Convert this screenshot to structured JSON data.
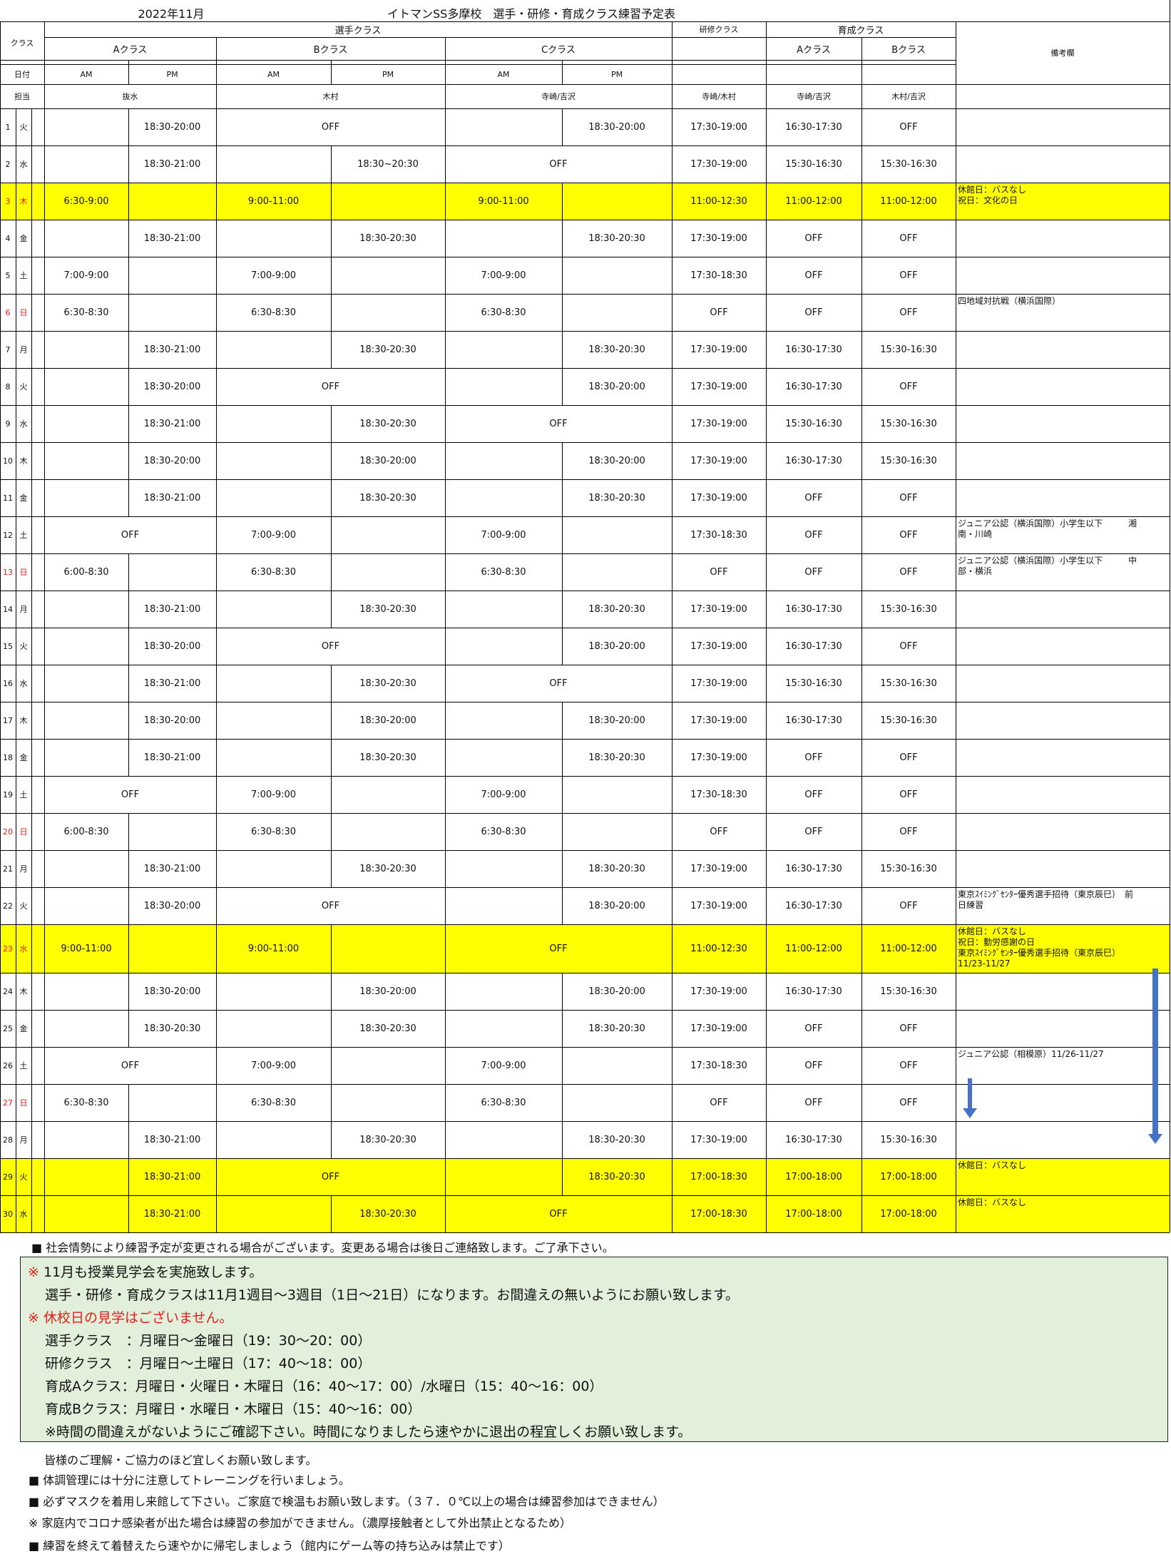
{
  "header": {
    "month": "2022年11月",
    "title": "イトマンSS多摩校　選手・研修・育成クラス練習予定表"
  },
  "labels": {
    "class": "クラス",
    "date": "日付",
    "staff": "担当",
    "senshu": "選手クラス",
    "kenshu": "研修クラス",
    "ikusei": "育成クラス",
    "a_class": "Aクラス",
    "b_class": "Bクラス",
    "c_class": "Cクラス",
    "biko": "備考欄",
    "am": "AM",
    "pm": "PM"
  },
  "staff": {
    "a": "抜水",
    "b": "木村",
    "c": "寺崎/吉沢",
    "kenshu": "寺崎/木村",
    "ikusei_a": "寺崎/吉沢",
    "ikusei_b": "木村/吉沢"
  },
  "colors": {
    "highlight": "#ffff00",
    "holiday_text": "#e0201a",
    "notes_background": "#e2efda",
    "arrow": "#4472c4"
  },
  "rows": [
    {
      "day": "1",
      "wd": "火",
      "red": false,
      "hl": false,
      "a": [
        "",
        "18:30-20:00"
      ],
      "b": [
        "OFF"
      ],
      "c": [
        "",
        "18:30-20:00"
      ],
      "ken": "17:30-19:00",
      "ia": "16:30-17:30",
      "ib": "OFF",
      "note": ""
    },
    {
      "day": "2",
      "wd": "水",
      "red": false,
      "hl": false,
      "a": [
        "",
        "18:30-21:00"
      ],
      "b": [
        "",
        "18:30~20:30"
      ],
      "c": [
        "OFF"
      ],
      "ken": "17:30-19:00",
      "ia": "15:30-16:30",
      "ib": "15:30-16:30",
      "note": ""
    },
    {
      "day": "3",
      "wd": "木",
      "red": true,
      "hl": true,
      "a": [
        "6:30-9:00",
        ""
      ],
      "b": [
        "9:00-11:00",
        ""
      ],
      "c": [
        "9:00-11:00",
        ""
      ],
      "ken": "11:00-12:30",
      "ia": "11:00-12:00",
      "ib": "11:00-12:00",
      "note": "休館日：バスなし\n祝日：文化の日"
    },
    {
      "day": "4",
      "wd": "金",
      "red": false,
      "hl": false,
      "a": [
        "",
        "18:30-21:00"
      ],
      "b": [
        "",
        "18:30-20:30"
      ],
      "c": [
        "",
        "18:30-20:30"
      ],
      "ken": "17:30-19:00",
      "ia": "OFF",
      "ib": "OFF",
      "note": ""
    },
    {
      "day": "5",
      "wd": "土",
      "red": false,
      "hl": false,
      "a": [
        "7:00-9:00",
        ""
      ],
      "b": [
        "7:00-9:00",
        ""
      ],
      "c": [
        "7:00-9:00",
        ""
      ],
      "ken": "17:30-18:30",
      "ia": "OFF",
      "ib": "OFF",
      "note": ""
    },
    {
      "day": "6",
      "wd": "日",
      "red": true,
      "hl": false,
      "a": [
        "6:30-8:30",
        ""
      ],
      "b": [
        "6:30-8:30",
        ""
      ],
      "c": [
        "6:30-8:30",
        ""
      ],
      "ken": "OFF",
      "ia": "OFF",
      "ib": "OFF",
      "note": "四地域対抗戦（横浜国際）"
    },
    {
      "day": "7",
      "wd": "月",
      "red": false,
      "hl": false,
      "a": [
        "",
        "18:30-21:00"
      ],
      "b": [
        "",
        "18:30-20:30"
      ],
      "c": [
        "",
        "18:30-20:30"
      ],
      "ken": "17:30-19:00",
      "ia": "16:30-17:30",
      "ib": "15:30-16:30",
      "note": ""
    },
    {
      "day": "8",
      "wd": "火",
      "red": false,
      "hl": false,
      "a": [
        "",
        "18:30-20:00"
      ],
      "b": [
        "OFF"
      ],
      "c": [
        "",
        "18:30-20:00"
      ],
      "ken": "17:30-19:00",
      "ia": "16:30-17:30",
      "ib": "OFF",
      "note": ""
    },
    {
      "day": "9",
      "wd": "水",
      "red": false,
      "hl": false,
      "a": [
        "",
        "18:30-21:00"
      ],
      "b": [
        "",
        "18:30-20:30"
      ],
      "c": [
        "OFF"
      ],
      "ken": "17:30-19:00",
      "ia": "15:30-16:30",
      "ib": "15:30-16:30",
      "note": ""
    },
    {
      "day": "10",
      "wd": "木",
      "red": false,
      "hl": false,
      "a": [
        "",
        "18:30-20:00"
      ],
      "b": [
        "",
        "18:30-20:00"
      ],
      "c": [
        "",
        "18:30-20:00"
      ],
      "ken": "17:30-19:00",
      "ia": "16:30-17:30",
      "ib": "15:30-16:30",
      "note": ""
    },
    {
      "day": "11",
      "wd": "金",
      "red": false,
      "hl": false,
      "a": [
        "",
        "18:30-21:00"
      ],
      "b": [
        "",
        "18:30-20:30"
      ],
      "c": [
        "",
        "18:30-20:30"
      ],
      "ken": "17:30-19:00",
      "ia": "OFF",
      "ib": "OFF",
      "note": ""
    },
    {
      "day": "12",
      "wd": "土",
      "red": false,
      "hl": false,
      "a": [
        "OFF"
      ],
      "b": [
        "7:00-9:00",
        ""
      ],
      "c": [
        "7:00-9:00",
        ""
      ],
      "ken": "17:30-18:30",
      "ia": "OFF",
      "ib": "OFF",
      "note": "ジュニア公認（横浜国際）小学生以下　　　湘\n南・川崎"
    },
    {
      "day": "13",
      "wd": "日",
      "red": true,
      "hl": false,
      "a": [
        "6:00-8:30",
        ""
      ],
      "b": [
        "6:30-8:30",
        ""
      ],
      "c": [
        "6:30-8:30",
        ""
      ],
      "ken": "OFF",
      "ia": "OFF",
      "ib": "OFF",
      "note": "ジュニア公認（横浜国際）小学生以下　　　中\n部・横浜"
    },
    {
      "day": "14",
      "wd": "月",
      "red": false,
      "hl": false,
      "a": [
        "",
        "18:30-21:00"
      ],
      "b": [
        "",
        "18:30-20:30"
      ],
      "c": [
        "",
        "18:30-20:30"
      ],
      "ken": "17:30-19:00",
      "ia": "16:30-17:30",
      "ib": "15:30-16:30",
      "note": ""
    },
    {
      "day": "15",
      "wd": "火",
      "red": false,
      "hl": false,
      "a": [
        "",
        "18:30-20:00"
      ],
      "b": [
        "OFF"
      ],
      "c": [
        "",
        "18:30-20:00"
      ],
      "ken": "17:30-19:00",
      "ia": "16:30-17:30",
      "ib": "OFF",
      "note": ""
    },
    {
      "day": "16",
      "wd": "水",
      "red": false,
      "hl": false,
      "a": [
        "",
        "18:30-21:00"
      ],
      "b": [
        "",
        "18:30-20:30"
      ],
      "c": [
        "OFF"
      ],
      "ken": "17:30-19:00",
      "ia": "15:30-16:30",
      "ib": "15:30-16:30",
      "note": ""
    },
    {
      "day": "17",
      "wd": "木",
      "red": false,
      "hl": false,
      "a": [
        "",
        "18:30-20:00"
      ],
      "b": [
        "",
        "18:30-20:00"
      ],
      "c": [
        "",
        "18:30-20:00"
      ],
      "ken": "17:30-19:00",
      "ia": "16:30-17:30",
      "ib": "15:30-16:30",
      "note": ""
    },
    {
      "day": "18",
      "wd": "金",
      "red": false,
      "hl": false,
      "a": [
        "",
        "18:30-21:00"
      ],
      "b": [
        "",
        "18:30-20:30"
      ],
      "c": [
        "",
        "18:30-20:30"
      ],
      "ken": "17:30-19:00",
      "ia": "OFF",
      "ib": "OFF",
      "note": ""
    },
    {
      "day": "19",
      "wd": "土",
      "red": false,
      "hl": false,
      "a": [
        "OFF"
      ],
      "b": [
        "7:00-9:00",
        ""
      ],
      "c": [
        "7:00-9:00",
        ""
      ],
      "ken": "17:30-18:30",
      "ia": "OFF",
      "ib": "OFF",
      "note": ""
    },
    {
      "day": "20",
      "wd": "日",
      "red": true,
      "hl": false,
      "a": [
        "6:00-8:30",
        ""
      ],
      "b": [
        "6:30-8:30",
        ""
      ],
      "c": [
        "6:30-8:30",
        ""
      ],
      "ken": "OFF",
      "ia": "OFF",
      "ib": "OFF",
      "note": ""
    },
    {
      "day": "21",
      "wd": "月",
      "red": false,
      "hl": false,
      "a": [
        "",
        "18:30-21:00"
      ],
      "b": [
        "",
        "18:30-20:30"
      ],
      "c": [
        "",
        "18:30-20:30"
      ],
      "ken": "17:30-19:00",
      "ia": "16:30-17:30",
      "ib": "15:30-16:30",
      "note": ""
    },
    {
      "day": "22",
      "wd": "火",
      "red": false,
      "hl": false,
      "a": [
        "",
        "18:30-20:00"
      ],
      "b": [
        "OFF"
      ],
      "c": [
        "",
        "18:30-20:00"
      ],
      "ken": "17:30-19:00",
      "ia": "16:30-17:30",
      "ib": "OFF",
      "note": "東京ｽｲﾐﾝｸﾞｾﾝﾀｰ優秀選手招待（東京辰巳）　前\n日練習"
    },
    {
      "day": "23",
      "wd": "水",
      "red": true,
      "hl": true,
      "a": [
        "9:00-11:00",
        ""
      ],
      "b": [
        "9:00-11:00",
        ""
      ],
      "c": [
        "OFF"
      ],
      "ken": "11:00-12:30",
      "ia": "11:00-12:00",
      "ib": "11:00-12:00",
      "note": "休館日：バスなし\n祝日：勤労感謝の日\n東京ｽｲﾐﾝｸﾞｾﾝﾀｰ優秀選手招待（東京辰巳）\n11/23-11/27"
    },
    {
      "day": "24",
      "wd": "木",
      "red": false,
      "hl": false,
      "a": [
        "",
        "18:30-20:00"
      ],
      "b": [
        "",
        "18:30-20:00"
      ],
      "c": [
        "",
        "18:30-20:00"
      ],
      "ken": "17:30-19:00",
      "ia": "16:30-17:30",
      "ib": "15:30-16:30",
      "note": ""
    },
    {
      "day": "25",
      "wd": "金",
      "red": false,
      "hl": false,
      "a": [
        "",
        "18:30-20:30"
      ],
      "b": [
        "",
        "18:30-20:30"
      ],
      "c": [
        "",
        "18:30-20:30"
      ],
      "ken": "17:30-19:00",
      "ia": "OFF",
      "ib": "OFF",
      "note": ""
    },
    {
      "day": "26",
      "wd": "土",
      "red": false,
      "hl": false,
      "a": [
        "OFF"
      ],
      "b": [
        "7:00-9:00",
        ""
      ],
      "c": [
        "7:00-9:00",
        ""
      ],
      "ken": "17:30-18:30",
      "ia": "OFF",
      "ib": "OFF",
      "note": "ジュニア公認（相模原）11/26-11/27"
    },
    {
      "day": "27",
      "wd": "日",
      "red": true,
      "hl": false,
      "a": [
        "6:30-8:30",
        ""
      ],
      "b": [
        "6:30-8:30",
        ""
      ],
      "c": [
        "6:30-8:30",
        ""
      ],
      "ken": "OFF",
      "ia": "OFF",
      "ib": "OFF",
      "note": ""
    },
    {
      "day": "28",
      "wd": "月",
      "red": false,
      "hl": false,
      "a": [
        "",
        "18:30-21:00"
      ],
      "b": [
        "",
        "18:30-20:30"
      ],
      "c": [
        "",
        "18:30-20:30"
      ],
      "ken": "17:30-19:00",
      "ia": "16:30-17:30",
      "ib": "15:30-16:30",
      "note": ""
    },
    {
      "day": "29",
      "wd": "火",
      "red": false,
      "hl": true,
      "a": [
        "",
        "18:30-21:00"
      ],
      "b": [
        "OFF"
      ],
      "c": [
        "",
        "18:30-20:30"
      ],
      "ken": "17:00-18:30",
      "ia": "17:00-18:00",
      "ib": "17:00-18:00",
      "note": "休館日：バスなし"
    },
    {
      "day": "30",
      "wd": "水",
      "red": false,
      "hl": true,
      "a": [
        "",
        "18:30-21:00"
      ],
      "b": [
        "",
        "18:30-20:30"
      ],
      "c": [
        "OFF"
      ],
      "ken": "17:00-18:30",
      "ia": "17:00-18:00",
      "ib": "17:00-18:00",
      "note": "休館日：バスなし"
    }
  ],
  "notice_top": "■ 社会情勢により練習予定が変更される場合がございます。変更ある場合は後日ご連絡致します。ご了承下さい。",
  "notes": {
    "line1_mark": "※",
    "line1": " 11月も授業見学会を実施致します。",
    "line2": "選手・研修・育成クラスは11月1週目～3週目（1日～21日）になります。お間違えの無いようにお願い致します。",
    "line3": "※ 休校日の見学はございません。",
    "line4": "選手クラス　：月曜日～金曜日（19：30～20：00）",
    "line5": "研修クラス　：月曜日～土曜日（17：40～18：00）",
    "line6": "育成Aクラス：月曜日・火曜日・木曜日（16：40～17：00）/水曜日（15：40～16：00）",
    "line7": "育成Bクラス：月曜日・水曜日・木曜日（15：40～16：00）",
    "line8": "※時間の間違えがないようにご確認下さい。時間になりましたら速やかに退出の程宜しくお願い致します。"
  },
  "footer": [
    {
      "mark": "",
      "text": "皆様のご理解・ご協力のほど宜しくお願い致します。"
    },
    {
      "mark": "■",
      "text": " 体調管理には十分に注意してトレーニングを行いましょう。"
    },
    {
      "mark": "■",
      "text": " 必ずマスクを着用し来館して下さい。ご家庭で検温もお願い致します。（３７．０℃以上の場合は練習参加はできません）"
    },
    {
      "mark": "※",
      "text": " 家庭内でコロナ感染者が出た場合は練習の参加ができません。（濃厚接触者として外出禁止となるため）"
    },
    {
      "mark": "■",
      "text": " 練習を終えて着替えたら速やかに帰宅しましょう（館内にゲーム等の持ち込みは禁止です）"
    }
  ]
}
